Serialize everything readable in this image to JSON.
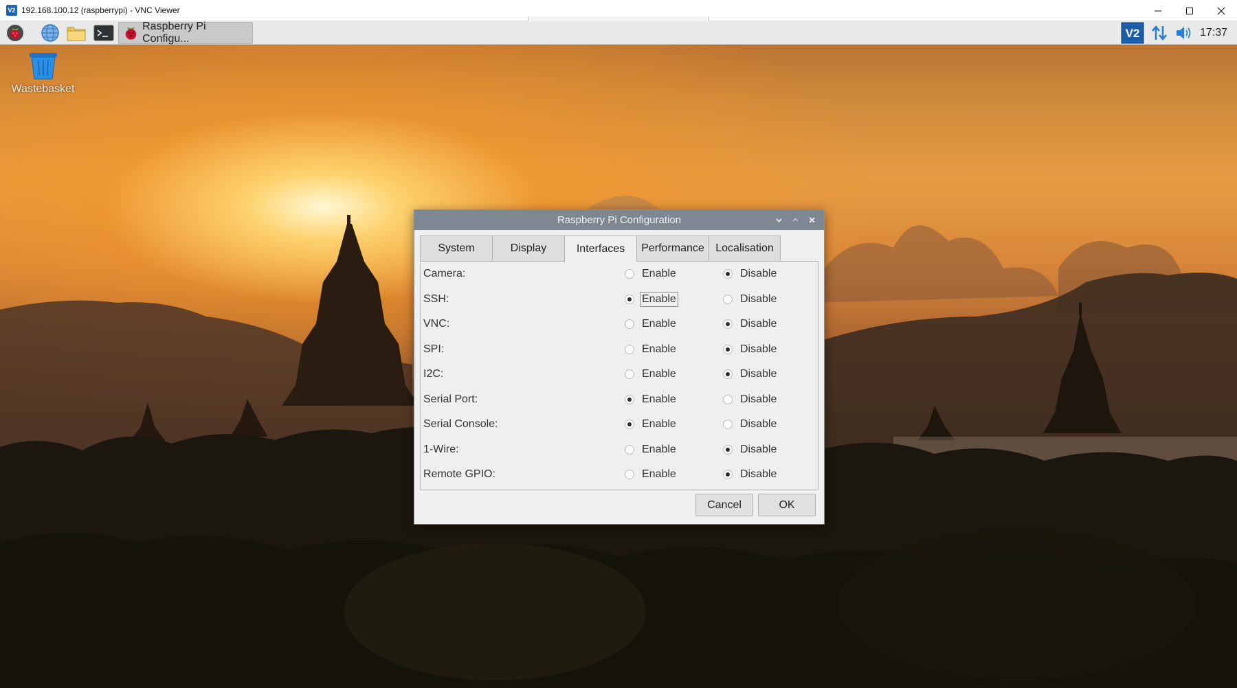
{
  "vnc_window": {
    "title": "192.168.100.12 (raspberrypi) - VNC Viewer",
    "logo": "V2",
    "controls": [
      "minimize-icon",
      "maximize-icon",
      "close-icon"
    ]
  },
  "panel": {
    "launchers": [
      "raspberry-menu-icon",
      "web-browser-icon",
      "file-manager-icon",
      "terminal-icon"
    ],
    "task_button_label": "Raspberry Pi Configu...",
    "tray": [
      "vnc-server-icon",
      "network-icon",
      "volume-icon"
    ],
    "vnc_tray_label": "V2",
    "clock": "17:37"
  },
  "desktop": {
    "wastebasket_label": "Wastebasket"
  },
  "dialog": {
    "title": "Raspberry Pi Configuration",
    "tabs": [
      {
        "label": "System"
      },
      {
        "label": "Display"
      },
      {
        "label": "Interfaces"
      },
      {
        "label": "Performance"
      },
      {
        "label": "Localisation"
      }
    ],
    "active_tab": "Interfaces",
    "enable_label": "Enable",
    "disable_label": "Disable",
    "interfaces": [
      {
        "label": "Camera:",
        "selected": "disable"
      },
      {
        "label": "SSH:",
        "selected": "enable",
        "focused": true
      },
      {
        "label": "VNC:",
        "selected": "disable"
      },
      {
        "label": "SPI:",
        "selected": "disable"
      },
      {
        "label": "I2C:",
        "selected": "disable"
      },
      {
        "label": "Serial Port:",
        "selected": "enable"
      },
      {
        "label": "Serial Console:",
        "selected": "enable"
      },
      {
        "label": "1-Wire:",
        "selected": "disable"
      },
      {
        "label": "Remote GPIO:",
        "selected": "disable"
      }
    ],
    "cancel_label": "Cancel",
    "ok_label": "OK"
  }
}
